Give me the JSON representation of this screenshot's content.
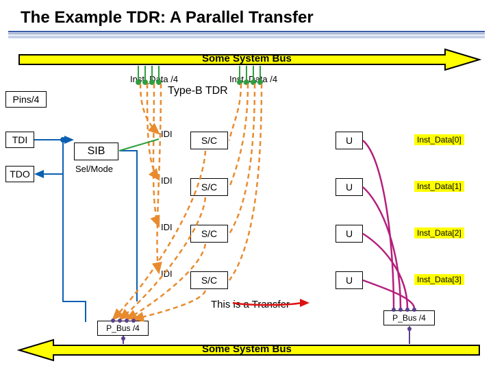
{
  "title": "The Example TDR: A Parallel Transfer",
  "bus_top_label": "Some System Bus",
  "bus_bottom_label": "Some System Bus",
  "inst_data_top_left": "Inst_Data /4",
  "inst_data_top_right": "Inst_Data /4",
  "type_label": "Type-B TDR",
  "pins_label": "Pins/4",
  "tdi_label": "TDI",
  "tdo_label": "TDO",
  "sib_label": "SIB",
  "selmode_label": "Sel/Mode",
  "rows": [
    {
      "idi": "IDI",
      "sc": "S/C",
      "u": "U",
      "inst": "Inst_Data[0]"
    },
    {
      "idi": "IDI",
      "sc": "S/C",
      "u": "U",
      "inst": "Inst_Data[1]"
    },
    {
      "idi": "IDI",
      "sc": "S/C",
      "u": "U",
      "inst": "Inst_Data[2]"
    },
    {
      "idi": "IDI",
      "sc": "S/C",
      "u": "U",
      "inst": "Inst_Data[3]"
    }
  ],
  "pbus_left": "P_Bus /4",
  "pbus_right": "P_Bus /4",
  "transfer_text": "This is a Transfer"
}
